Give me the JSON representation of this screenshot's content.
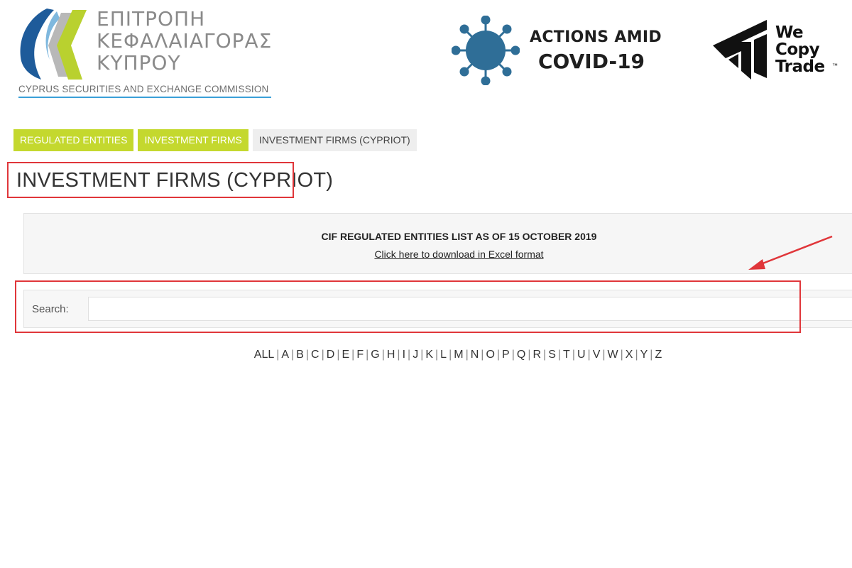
{
  "header": {
    "cysec_logo": {
      "greek_lines": [
        "ΕΠΙΤΡΟΠΗ",
        "ΚΕΦΑΛΑΙΑΓΟΡΑΣ",
        "ΚΥΠΡΟΥ"
      ],
      "english_name": "CYPRUS SECURITIES AND EXCHANGE COMMISSION",
      "colors": {
        "blue": "#1e5b9a",
        "green": "#b9d12f",
        "grey": "#8a8a8a",
        "underline": "#3aa0d8"
      }
    },
    "covid_banner": {
      "line1": "ACTIONS AMID",
      "line2": "COVID-19",
      "icon": "virus-icon",
      "icon_color": "#2f6e97"
    },
    "wecopytrade_logo": {
      "lines": [
        "We",
        "Copy",
        "Trade"
      ],
      "tm": "™",
      "icon": "wct-chevron-logo"
    }
  },
  "breadcrumb": {
    "items": [
      {
        "label": "REGULATED ENTITIES"
      },
      {
        "label": "INVESTMENT FIRMS"
      },
      {
        "label": "INVESTMENT FIRMS (CYPRIOT)"
      }
    ],
    "active_color": "#c4d82e"
  },
  "page": {
    "title": "INVESTMENT FIRMS (CYPRIOT)"
  },
  "download_panel": {
    "list_title": "CIF REGULATED ENTITIES LIST AS OF 15 OCTOBER 2019",
    "download_link": "Click here to download in Excel format"
  },
  "search": {
    "label": "Search:",
    "value": "",
    "placeholder": ""
  },
  "alphabet": {
    "letters": [
      "ALL",
      "A",
      "B",
      "C",
      "D",
      "E",
      "F",
      "G",
      "H",
      "I",
      "J",
      "K",
      "L",
      "M",
      "N",
      "O",
      "P",
      "Q",
      "R",
      "S",
      "T",
      "U",
      "V",
      "W",
      "X",
      "Y",
      "Z"
    ]
  },
  "annotations": {
    "highlight_color": "#e0363a"
  }
}
